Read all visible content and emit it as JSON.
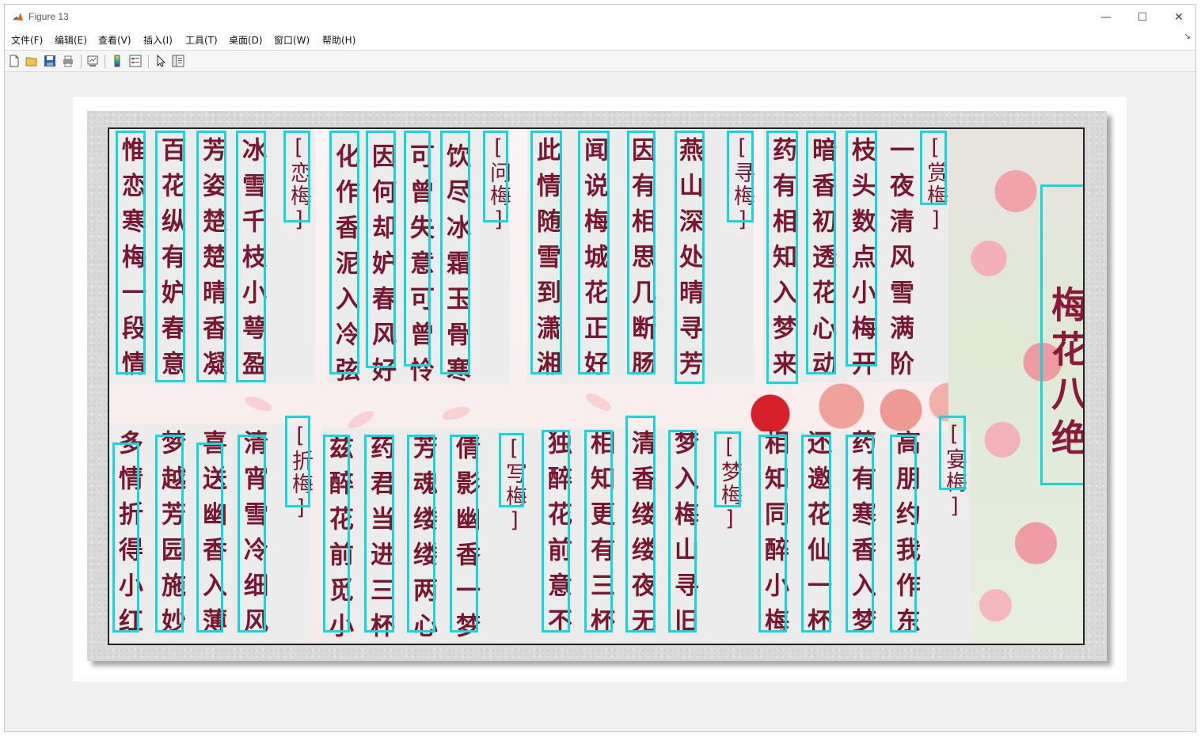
{
  "window": {
    "title": "Figure 13",
    "controls": {
      "minimize": "—",
      "maximize": "☐",
      "close": "✕"
    }
  },
  "menu": {
    "items": [
      "文件(F)",
      "编辑(E)",
      "查看(V)",
      "插入(I)",
      "工具(T)",
      "桌面(D)",
      "窗口(W)",
      "帮助(H)"
    ],
    "overflow_arrow": "↘"
  },
  "toolbar": {
    "buttons": [
      "new-figure-icon",
      "open-file-icon",
      "save-icon",
      "print-icon",
      "link-plot-icon",
      "colorbar-icon",
      "legend-icon",
      "edit-plot-icon",
      "property-inspector-icon"
    ]
  },
  "poem": {
    "main_title": "梅花八绝",
    "top_row": [
      {
        "title": "[恋梅]",
        "lines": [
          "惟恋寒梅一段情",
          "百花纵有妒春意",
          "芳姿楚楚晴香凝",
          "冰雪千枝小萼盈"
        ]
      },
      {
        "title": "[问梅]",
        "lines": [
          "化作香泥入冷弦",
          "因何却妒春风好",
          "可曾失意可曾怜",
          "饮尽冰霜玉骨寒"
        ]
      },
      {
        "title": "[寻梅]",
        "lines": [
          "此情随雪到潇湘",
          "闻说梅城花正好",
          "因有相思几断肠",
          "燕山深处晴寻芳"
        ]
      },
      {
        "title": "[赏梅]",
        "lines": [
          "药有相知入梦来",
          "暗香初透花心动",
          "枝头数点小梅开",
          "一夜清风雪满阶"
        ]
      }
    ],
    "bottom_row": [
      {
        "title": "[折梅]",
        "lines": [
          "多情折得小红梅",
          "梦越芳园施妙手",
          "喜送幽香入薄帏",
          "清宵雪冷细风吹"
        ]
      },
      {
        "title": "[写梅]",
        "lines": [
          "兹醉花前觅小诗",
          "药君当进三杯酒",
          "芳魂缕缕两心知",
          "倩影幽香一梦痴"
        ]
      },
      {
        "title": "[梦梅]",
        "lines": [
          "独醉花前意不休",
          "相知更有三杯饮",
          "清香缕缕夜无愁",
          "梦入梅山寻旧游"
        ]
      },
      {
        "title": "[宴梅]",
        "lines": [
          "相知同醉小梅红",
          "还邀花仙一杯酒",
          "药有寒香入梦中",
          "高朋约我作东翁"
        ]
      }
    ]
  },
  "colors": {
    "bbox": "#12d8dc",
    "text": "#7a1730",
    "panel": "#ececec"
  }
}
